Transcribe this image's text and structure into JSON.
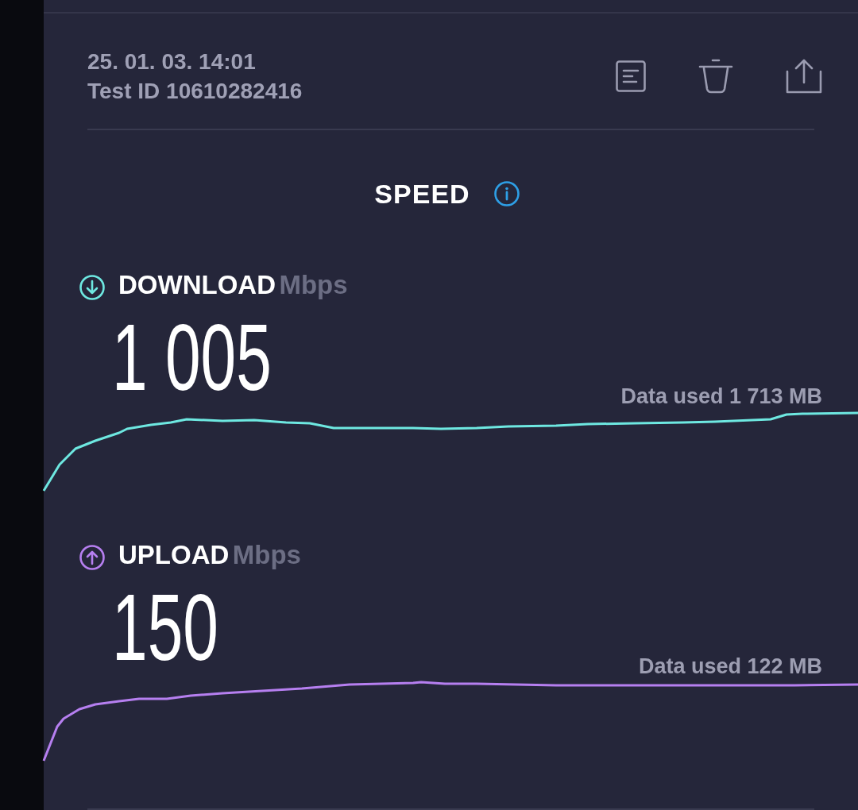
{
  "test": {
    "date": "25. 01. 03. 14:01",
    "test_id": "Test ID 10610282416"
  },
  "section": {
    "title": "SPEED"
  },
  "metrics": [
    {
      "kind": "download",
      "label": "DOWNLOAD",
      "unit": "Mbps",
      "value": "1 005",
      "data_used": "Data used 1 713 MB",
      "color": "#6ee8e1"
    },
    {
      "kind": "upload",
      "label": "UPLOAD",
      "unit": "Mbps",
      "value": "150",
      "data_used": "Data used 122 MB",
      "color": "#b67ff0"
    }
  ]
}
